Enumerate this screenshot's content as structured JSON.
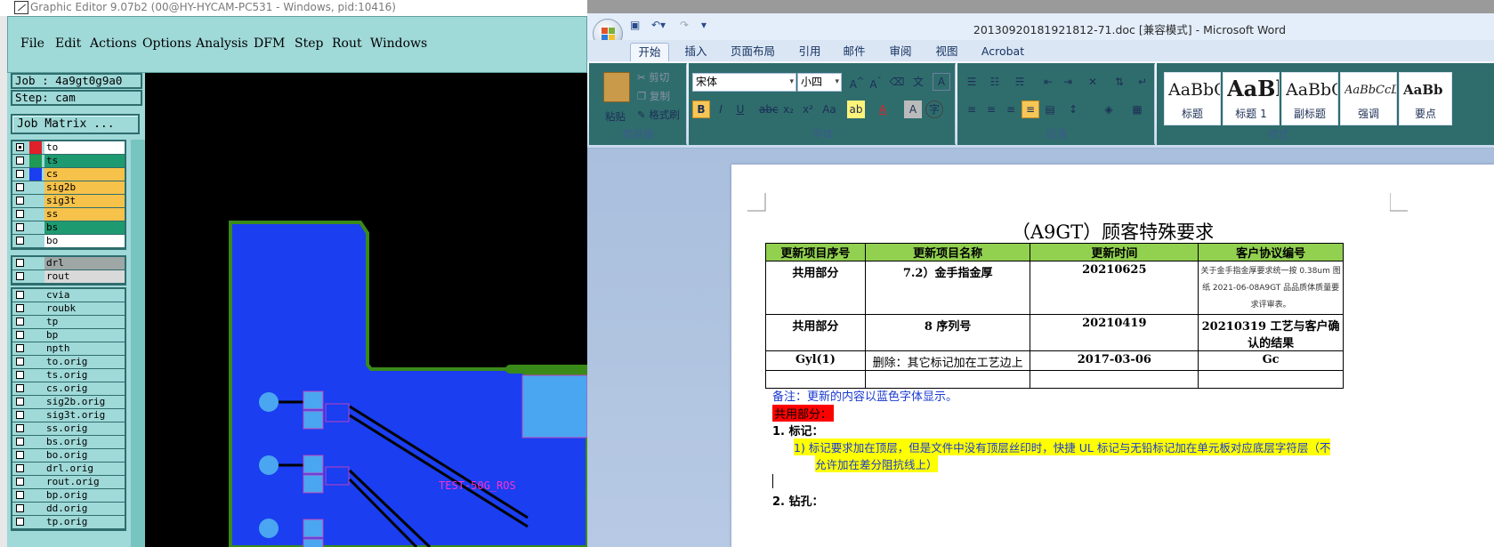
{
  "graphic_editor": {
    "title": "Graphic Editor 9.07b2 (00@HY-HYCAM-PC531 - Windows, pid:10416)",
    "menu": [
      "File",
      "Edit",
      "Actions",
      "Options",
      "Analysis",
      "DFM",
      "Step",
      "Rout",
      "Windows"
    ],
    "job_label": "Job : 4a9gt0g9a0",
    "step_label": "Step: cam",
    "job_matrix_button": "Job Matrix ...",
    "layer_groups": [
      {
        "layers": [
          {
            "name": "to",
            "color": "#e0202a",
            "bg": "#ffffff",
            "selected": true
          },
          {
            "name": "ts",
            "color": "#1e9a55",
            "bg": "#1e9a70"
          },
          {
            "name": "cs",
            "color": "#1a3ef0",
            "bg": "#f7c24a"
          },
          {
            "name": "sig2b",
            "color": "#9fd9d8",
            "bg": "#f7c24a"
          },
          {
            "name": "sig3t",
            "color": "#9fd9d8",
            "bg": "#f7c24a"
          },
          {
            "name": "ss",
            "color": "#9fd9d8",
            "bg": "#f7c24a"
          },
          {
            "name": "bs",
            "color": "#9fd9d8",
            "bg": "#1e9a70"
          },
          {
            "name": "bo",
            "color": "#9fd9d8",
            "bg": "#ffffff"
          }
        ]
      },
      {
        "layers": [
          {
            "name": "drl",
            "color": "#9fd9d8",
            "bg": "#9fa6a6"
          },
          {
            "name": "rout",
            "color": "#9fd9d8",
            "bg": "#d9d9d9"
          }
        ]
      },
      {
        "layers": [
          {
            "name": "cvia",
            "color": "#9fd9d8",
            "bg": "#9fd9d8"
          },
          {
            "name": "roubk",
            "color": "#9fd9d8",
            "bg": "#9fd9d8"
          },
          {
            "name": "tp",
            "color": "#9fd9d8",
            "bg": "#9fd9d8"
          },
          {
            "name": "bp",
            "color": "#9fd9d8",
            "bg": "#9fd9d8"
          },
          {
            "name": "npth",
            "color": "#9fd9d8",
            "bg": "#9fd9d8"
          },
          {
            "name": "to.orig",
            "color": "#9fd9d8",
            "bg": "#9fd9d8"
          },
          {
            "name": "ts.orig",
            "color": "#9fd9d8",
            "bg": "#9fd9d8"
          },
          {
            "name": "cs.orig",
            "color": "#9fd9d8",
            "bg": "#9fd9d8"
          },
          {
            "name": "sig2b.orig",
            "color": "#9fd9d8",
            "bg": "#9fd9d8"
          },
          {
            "name": "sig3t.orig",
            "color": "#9fd9d8",
            "bg": "#9fd9d8"
          },
          {
            "name": "ss.orig",
            "color": "#9fd9d8",
            "bg": "#9fd9d8"
          },
          {
            "name": "bs.orig",
            "color": "#9fd9d8",
            "bg": "#9fd9d8"
          },
          {
            "name": "bo.orig",
            "color": "#9fd9d8",
            "bg": "#9fd9d8"
          },
          {
            "name": "drl.orig",
            "color": "#9fd9d8",
            "bg": "#9fd9d8"
          },
          {
            "name": "rout.orig",
            "color": "#9fd9d8",
            "bg": "#9fd9d8"
          },
          {
            "name": "bp.orig",
            "color": "#9fd9d8",
            "bg": "#9fd9d8"
          },
          {
            "name": "dd.orig",
            "color": "#9fd9d8",
            "bg": "#9fd9d8"
          },
          {
            "name": "tp.orig",
            "color": "#9fd9d8",
            "bg": "#9fd9d8"
          }
        ]
      }
    ],
    "canvas_text": "TEST-50G_ROS"
  },
  "word": {
    "title": "20130920181921812-71.doc [兼容模式] - Microsoft Word",
    "tabs": [
      "开始",
      "插入",
      "页面布局",
      "引用",
      "邮件",
      "审阅",
      "视图",
      "Acrobat"
    ],
    "clipboard": {
      "paste": "粘贴",
      "cut": "剪切",
      "copy": "复制",
      "format_painter": "格式刷",
      "label": "剪贴板"
    },
    "font": {
      "name": "宋体",
      "size": "小四",
      "label": "字体"
    },
    "paragraph_label": "段落",
    "styles_label": "样式",
    "styles": [
      {
        "preview": "AaBbC",
        "name": "标题"
      },
      {
        "preview": "AaBl",
        "name": "标题 1"
      },
      {
        "preview": "AaBbC",
        "name": "副标题"
      },
      {
        "preview": "AaBbCcDc",
        "name": "强调"
      },
      {
        "preview": "AaBb",
        "name": "要点"
      }
    ],
    "document": {
      "title": "（A9GT）顾客特殊要求",
      "table_headers": [
        "更新项目序号",
        "更新项目名称",
        "更新时间",
        "客户协议编号"
      ],
      "rows": [
        [
          "共用部分",
          "7.2）金手指金厚",
          "20210625",
          "关于金手指金厚要求统一按 0.38um 图纸 2021-06-08A9GT 品品质体质量要求评审表。"
        ],
        [
          "共用部分",
          "8 序列号",
          "20210419",
          "20210319 工艺与客户确认的结果"
        ],
        [
          "Gyl(1)",
          "删除：其它标记加在工艺边上",
          "2017-03-06",
          "Gc"
        ],
        [
          "",
          "",
          "",
          ""
        ]
      ],
      "note": "备注：更新的内容以蓝色字体显示。",
      "section": "共用部分：",
      "item1": "1.    标记：",
      "item1_sub": "1)  标记要求加在顶层，但是文件中没有顶层丝印时，快捷 UL 标记与无铅标记加在单元板对应底层字符层（不",
      "item1_sub2": "允许加在差分阻抗线上）",
      "item2": "2.    钻孔："
    }
  }
}
